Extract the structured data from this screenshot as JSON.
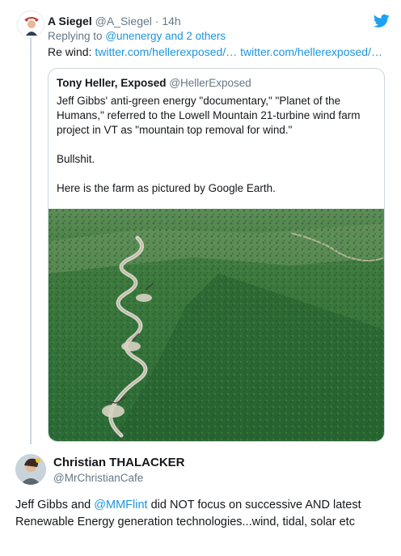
{
  "tweet": {
    "author_name": "A Siegel",
    "author_handle": "@A_Siegel",
    "separator": "·",
    "time": "14h",
    "replying_prefix": "Replying to",
    "replying_handle": "@unenergy",
    "replying_suffix": "and 2 others",
    "body_prefix": "Re wind:",
    "link1": "twitter.com/hellerexposed/…",
    "link2": "twitter.com/hellerexposed/…"
  },
  "quoted": {
    "author_name": "Tony Heller, Exposed",
    "author_handle": "@HellerExposed",
    "paragraph1": "Jeff Gibbs' anti-green energy \"documentary,\" \"Planet of the Humans,\" referred to the Lowell Mountain 21-turbine wind farm project in VT as \"mountain top removal for wind.\"",
    "paragraph2": "Bullshit.",
    "paragraph3": "Here is the farm as pictured by Google Earth."
  },
  "reply": {
    "author_name": "Christian THALACKER",
    "author_handle": "@MrChristianCafe",
    "text_before": "Jeff Gibbs and ",
    "mention": "@MMFlint",
    "text_after": " did NOT focus on successive AND latest Renewable Energy generation technologies...wind, tidal, solar etc"
  },
  "icons": {
    "brand": "twitter-bird-icon"
  },
  "colors": {
    "link": "#1b95e0",
    "muted": "#657786",
    "border": "#ccd6dd",
    "forest": "#2f6a36"
  }
}
